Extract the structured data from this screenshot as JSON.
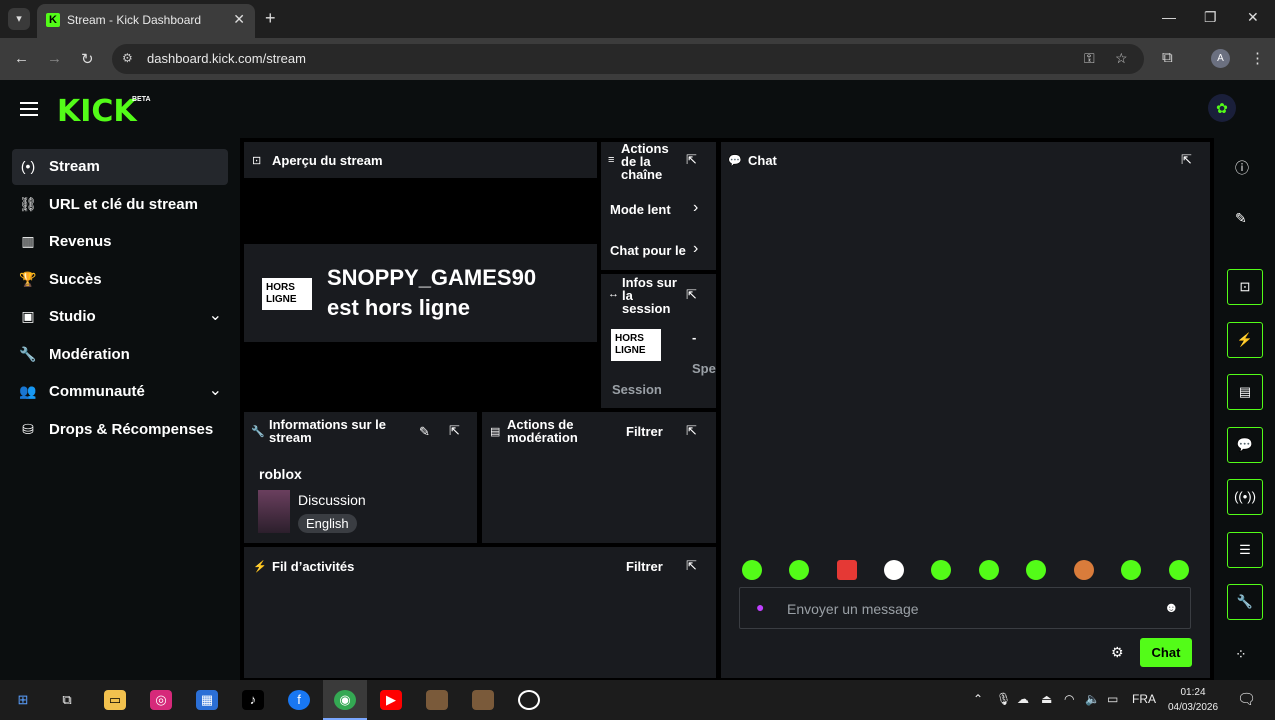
{
  "browser": {
    "tab_title": "Stream - Kick Dashboard",
    "url": "dashboard.kick.com/stream",
    "profile_initial": "A"
  },
  "app": {
    "logo": "KICK",
    "logo_badge": "BETA",
    "brand_color": "#53fc18"
  },
  "sidebar": {
    "items": [
      {
        "label": "Stream",
        "icon": "broadcast-icon"
      },
      {
        "label": "URL et clé du stream",
        "icon": "link-icon"
      },
      {
        "label": "Revenus",
        "icon": "revenue-icon"
      },
      {
        "label": "Succès",
        "icon": "trophy-icon"
      },
      {
        "label": "Studio",
        "icon": "studio-icon"
      },
      {
        "label": "Modération",
        "icon": "wrench-icon"
      },
      {
        "label": "Communauté",
        "icon": "community-icon"
      },
      {
        "label": "Drops & Récompenses",
        "icon": "drops-icon"
      }
    ]
  },
  "preview": {
    "title": "Aperçu du stream",
    "offline_badge": "HORS LIGNE",
    "offline_line1": "SNOPPY_GAMES90",
    "offline_line2": "est hors ligne"
  },
  "channel_actions": {
    "title": "Actions de la chaîne",
    "items": [
      "Mode lent",
      "Chat pour le"
    ]
  },
  "session": {
    "title": "Infos sur la session",
    "badge": "HORS LIGNE",
    "dash": "-",
    "spe": "Spe",
    "label": "Session"
  },
  "stream_info": {
    "title": "Informations sur le stream",
    "stream_title": "roblox",
    "category": "Discussion",
    "language": "English"
  },
  "mod_actions": {
    "title": "Actions de modération",
    "filter": "Filtrer"
  },
  "activity": {
    "title": "Fil d’activités",
    "filter": "Filtrer"
  },
  "chat": {
    "title": "Chat",
    "placeholder": "Envoyer un message",
    "send_label": "Chat"
  },
  "taskbar": {
    "lang": "FRA",
    "time": "01:24",
    "date": "04/03/2026"
  }
}
